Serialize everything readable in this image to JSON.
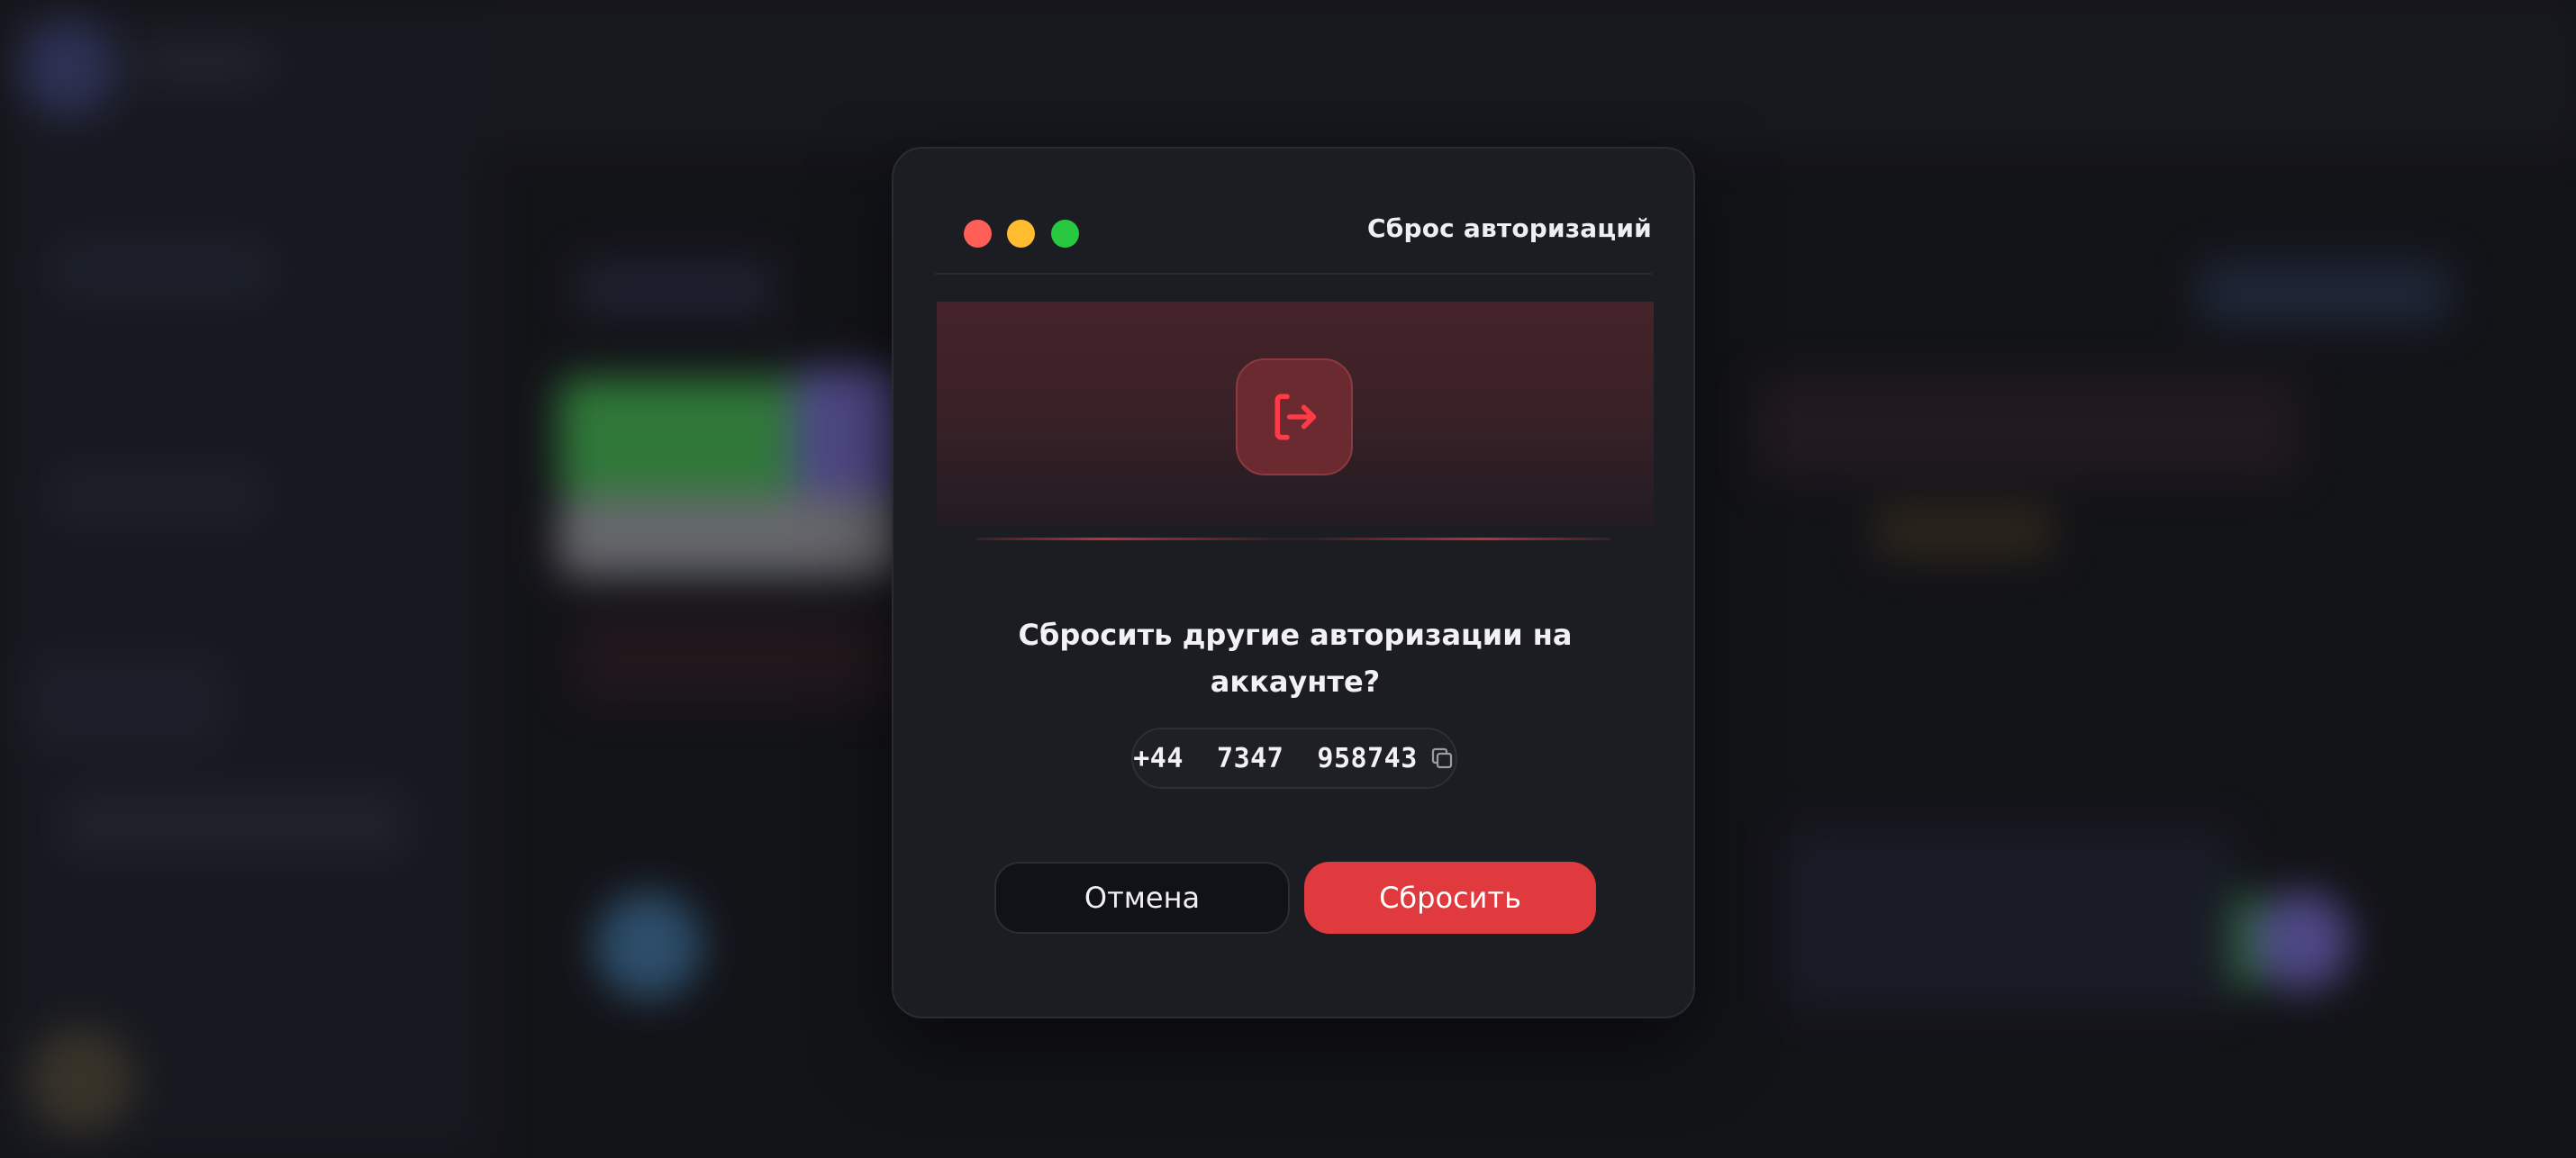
{
  "dialog": {
    "title": "Сброс авторизаций",
    "icon": "logout-icon",
    "question": "Сбросить другие авторизации на аккаунте?",
    "phone": "+44  7347  958743",
    "copy_icon": "copy-icon",
    "cancel_label": "Отмена",
    "confirm_label": "Сбросить"
  },
  "colors": {
    "accent": "#e0393e",
    "modal_bg": "#1c1d23",
    "page_bg": "#16171c",
    "traffic_red": "#ff5f57",
    "traffic_yellow": "#febc2e",
    "traffic_green": "#28c840"
  }
}
